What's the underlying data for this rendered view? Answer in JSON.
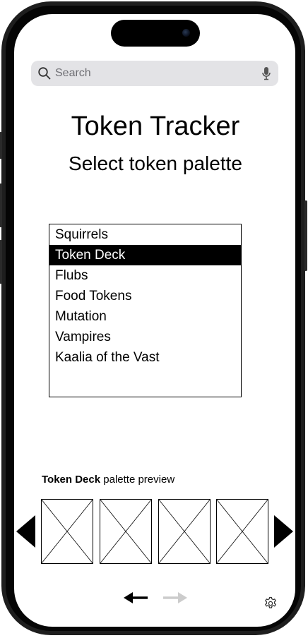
{
  "search": {
    "placeholder": "Search"
  },
  "header": {
    "title": "Token Tracker",
    "subtitle": "Select token palette"
  },
  "palette_list": {
    "items": [
      {
        "label": "Squirrels",
        "selected": false
      },
      {
        "label": "Token Deck",
        "selected": true
      },
      {
        "label": "Flubs",
        "selected": false
      },
      {
        "label": "Food Tokens",
        "selected": false
      },
      {
        "label": "Mutation",
        "selected": false
      },
      {
        "label": "Vampires",
        "selected": false
      },
      {
        "label": "Kaalia of the Vast",
        "selected": false
      }
    ]
  },
  "preview": {
    "palette_name": "Token Deck",
    "suffix": " palette preview",
    "tiles": [
      "token-placeholder-1",
      "token-placeholder-2",
      "token-placeholder-3",
      "token-placeholder-4"
    ]
  },
  "nav": {
    "back_icon": "arrow-left-icon",
    "forward_icon": "arrow-right-icon",
    "forward_enabled": false,
    "settings_icon": "gear-icon"
  },
  "colors": {
    "selected_background": "#000000",
    "selected_text": "#ffffff",
    "disabled_arrow": "#cccccc",
    "search_background": "#e3e3e6"
  }
}
